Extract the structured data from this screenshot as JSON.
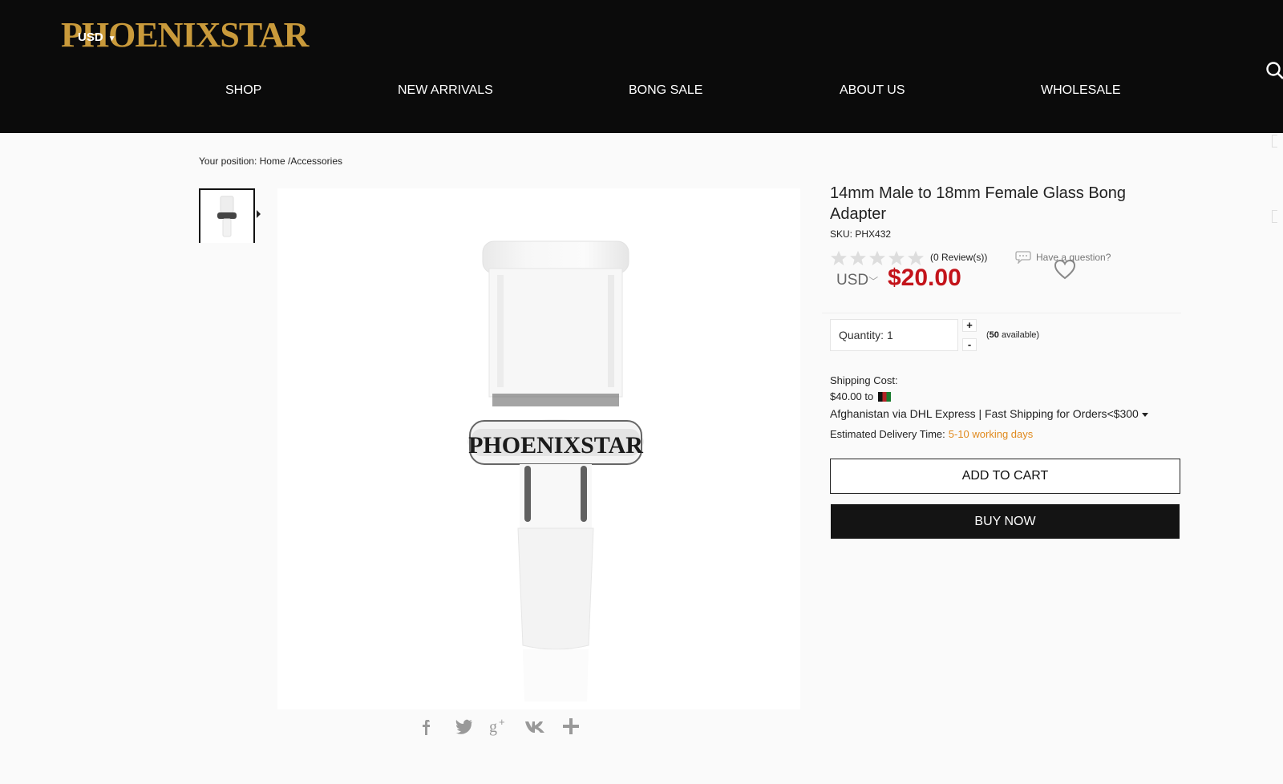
{
  "header": {
    "logo": "PHOENIXSTAR",
    "currency": "USD",
    "nav": [
      "SHOP",
      "NEW ARRIVALS",
      "BONG SALE",
      "ABOUT US",
      "WHOLESALE"
    ]
  },
  "breadcrumb": {
    "label": "Your position:",
    "home": "Home",
    "sep": "/",
    "category": "Accessories"
  },
  "product": {
    "title": "14mm Male to 18mm Female Glass Bong Adapter",
    "sku_label": "SKU:",
    "sku": "PHX432",
    "rating": 0,
    "reviews": "(0 Review(s))",
    "question": "Have a question?",
    "currency": "USD",
    "price": "$20.00",
    "image_logo": "PHOENIXSTAR"
  },
  "quantity": {
    "label": "Quantity:",
    "value": "1",
    "plus": "+",
    "minus": "-",
    "available_open": "(",
    "available_count": "50",
    "available_text": " available)"
  },
  "shipping": {
    "label": "Shipping Cost:",
    "cost": "$40.00 to",
    "method": "Afghanistan via DHL Express | Fast Shipping for Orders<$300",
    "delivery_label": "Estimated Delivery Time:",
    "delivery_days": "5-10 working days"
  },
  "buttons": {
    "add_to_cart": "ADD TO CART",
    "buy_now": "BUY NOW"
  },
  "share": [
    "facebook-icon",
    "twitter-icon",
    "google-plus-icon",
    "vk-icon",
    "more-icon"
  ],
  "colors": {
    "header_bg": "#0b0b0b",
    "logo_gold": "#c99a3b",
    "price_red": "#c3131a",
    "delivery_orange": "#e08a1e"
  }
}
